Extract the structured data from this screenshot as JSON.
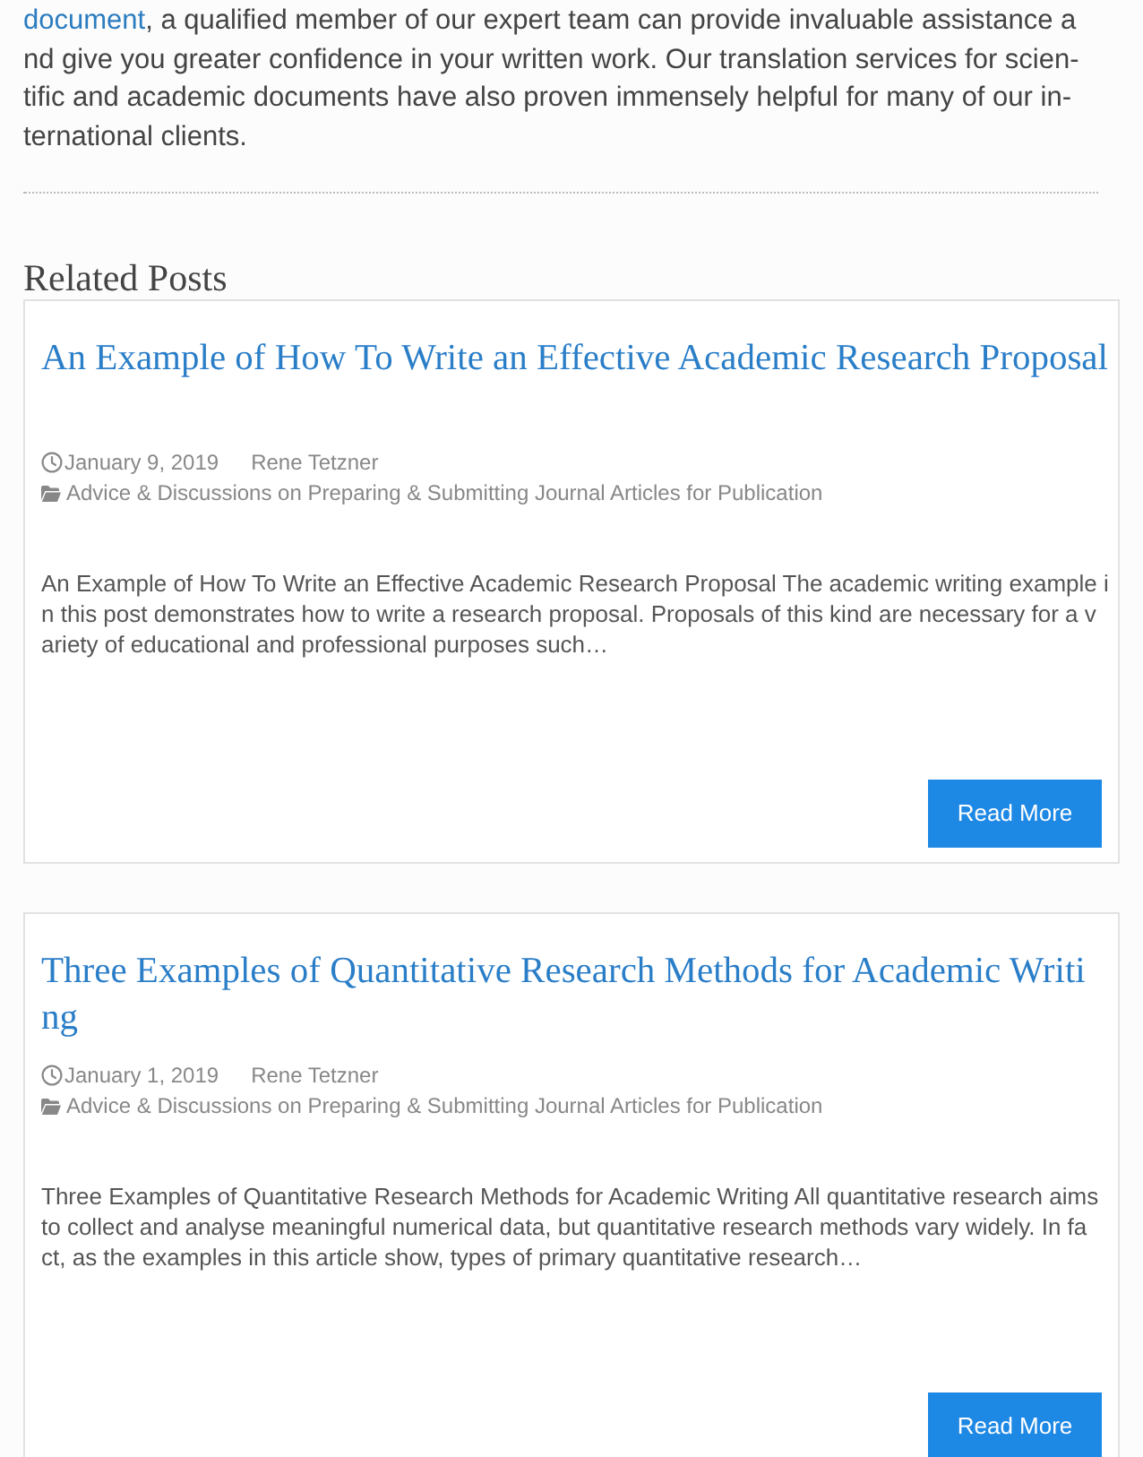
{
  "intro": {
    "link": "document",
    "lines": [
      ", a qualified member of our expert team can provide invaluable assistance a",
      "nd give you greater confidence in your written work. Our translation services for scien-",
      "tific and academic documents have also proven immensely helpful for many of our in-",
      "ternational clients."
    ]
  },
  "heading": "Related Posts",
  "posts": [
    {
      "title_lines": [
        "An Example of How To Write an Effective Academic Research Proposal"
      ],
      "date": "January 9, 2019",
      "author": "Rene Tetzner",
      "category": "Advice & Discussions on Preparing & Submitting Journal Articles for Publication",
      "excerpt_lines": [
        "An Example of How To Write an Effective Academic Research Proposal The academic writing example i",
        "n this post demonstrates how to write a research proposal. Proposals of this kind are necessary for a v",
        "ariety of educational and professional purposes such…"
      ],
      "button": "Read More"
    },
    {
      "title_lines": [
        "Three Examples of Quantitative Research Methods for Academic Writi",
        "ng"
      ],
      "date": "January 1, 2019",
      "author": "Rene Tetzner",
      "category": "Advice & Discussions on Preparing & Submitting Journal Articles for Publication",
      "excerpt_lines": [
        "Three Examples of Quantitative Research Methods for Academic Writing All quantitative research aims",
        "to collect and analyse meaningful numerical data, but quantitative research methods vary widely. In fa",
        "ct, as the examples in this article show, types of primary quantitative research…"
      ],
      "button": "Read More"
    }
  ]
}
